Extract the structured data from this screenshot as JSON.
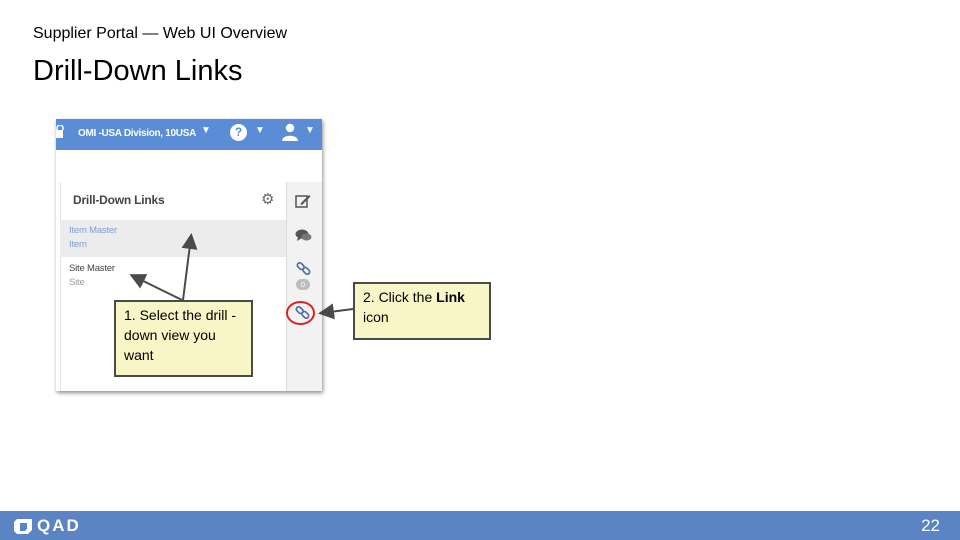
{
  "header": {
    "subtitle": "Supplier Portal — Web UI Overview",
    "title": "Drill-Down Links"
  },
  "screenshot": {
    "topbar": {
      "division": "OMI -USA Division, 10USA",
      "help_glyph": "?"
    },
    "panel": {
      "title": "Drill-Down Links",
      "items": [
        {
          "label": "Item Master",
          "sub": "Item",
          "selected": true
        },
        {
          "label": "Site Master",
          "sub": "Site",
          "selected": false
        }
      ]
    },
    "rail": {
      "icons": [
        "edit-icon",
        "chat-icon",
        "link-icon",
        "link-icon"
      ],
      "badge": "0"
    }
  },
  "callouts": {
    "select": "1. Select the drill -down view you want",
    "click_prefix": "2. Click the ",
    "click_bold": "Link",
    "click_suffix": " icon"
  },
  "footer": {
    "logo_text": "QAD",
    "page_number": "22"
  },
  "colors": {
    "accent_blue": "#5b8dd6",
    "footer_blue": "#5a84c4",
    "callout_fill": "#f8f6c6",
    "highlight_red": "#e02020"
  }
}
